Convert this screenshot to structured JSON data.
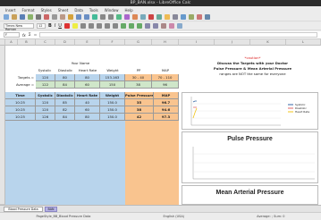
{
  "window": {
    "title": "BP_BAN.xlsx - LibreOffice Calc"
  },
  "menu": [
    "Insert",
    "Format",
    "Styles",
    "Sheet",
    "Data",
    "Tools",
    "Window",
    "Help"
  ],
  "toolbar": {
    "font_name": "Times New Roman",
    "font_size": "12"
  },
  "formula_bar": {
    "name_box": "F",
    "fx": "fx",
    "sum": "Σ",
    "eq": "="
  },
  "columns": [
    "A",
    "B",
    "C",
    "D",
    "E",
    "F",
    "G",
    "H",
    "I",
    "J",
    "K",
    "L"
  ],
  "summary": {
    "group_label": "Your Name",
    "headers": [
      "Systolic",
      "Diastolic",
      "Heart Rate",
      "Weight",
      "PP",
      "MAP"
    ],
    "targets_label": "Targets =",
    "targets": [
      "120",
      "80",
      "80",
      "153.163",
      "30 - 40",
      "70 - 110"
    ],
    "average_label": "Average =",
    "averages": [
      "122",
      "84",
      "60",
      "150",
      "38",
      "96"
    ]
  },
  "note": {
    "caution": "*caution*",
    "line1": "Discuss the Targets with your Doctor",
    "line2": "Pulse Pressure & Mean Arterial Pressure",
    "line3": "ranges are NOT the same for everyone"
  },
  "table": {
    "headers": [
      "Time",
      "Systolic",
      "Diastolic",
      "Heart Rate",
      "Weight",
      "Pulse Pressure",
      "MAP"
    ],
    "rows": [
      [
        "10:25",
        "120",
        "85",
        "40",
        "150.0",
        "35",
        "96.7"
      ],
      [
        "10:25",
        "120",
        "82",
        "60",
        "150.0",
        "38",
        "94.6"
      ],
      [
        "10:25",
        "126",
        "84",
        "80",
        "150.0",
        "42",
        "97.3"
      ]
    ]
  },
  "charts": {
    "top_legend": [
      "Systolic",
      "Diastolic",
      "Heart Rate"
    ],
    "pulse_title": "Pulse Pressure",
    "map_title": "Mean Arterial Pressure"
  },
  "sheet_tabs": [
    "Blood Pressure Data",
    "BAN"
  ],
  "status": {
    "sheet_info": "PageStyle_BB_Blood Pressure Data",
    "language": "English (USA)",
    "zoom": "Average: ; Sum: 0"
  },
  "colors": {
    "blue_fill": "#b8d4ec",
    "orange_fill": "#f9c48f",
    "green_fill": "#cfe6c9",
    "header_gray": "#e4e4e4"
  }
}
